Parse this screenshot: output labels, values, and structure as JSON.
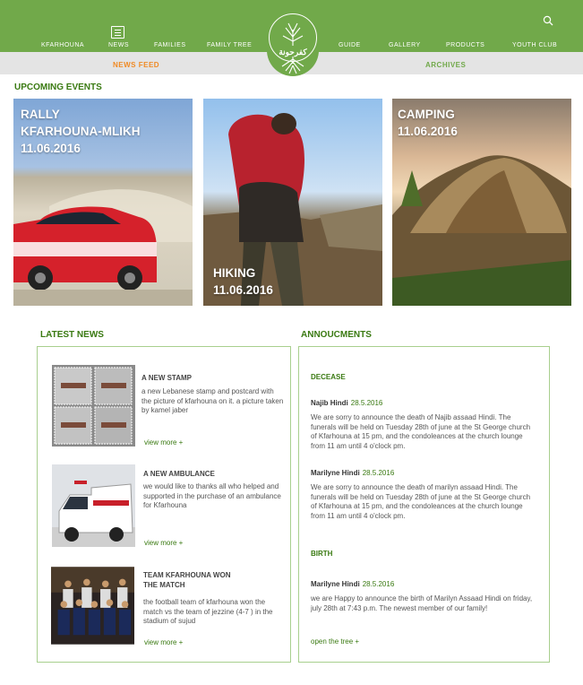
{
  "nav": {
    "left": [
      "KFARHOUNA",
      "NEWS",
      "FAMILIES",
      "FAMILY TREE"
    ],
    "right": [
      "GUIDE",
      "GALLERY",
      "PRODUCTS",
      "YOUTH CLUB"
    ]
  },
  "logo": {
    "arabic": "كفرحونة"
  },
  "subnav": {
    "feed": "NEWS FEED",
    "archives": "ARCHIVES"
  },
  "events": {
    "title": "UPCOMING EVENTS",
    "items": [
      {
        "line1": "RALLY",
        "line2": "KFARHOUNA-MLIKH",
        "date": "11.06.2016"
      },
      {
        "line1": "HIKING",
        "date": "11.06.2016"
      },
      {
        "line1": "CAMPING",
        "date": "11.06.2016"
      }
    ]
  },
  "news": {
    "title": "LATEST NEWS",
    "items": [
      {
        "title": "A NEW STAMP",
        "text": "a new Lebanese stamp and postcard with the picture of kfarhouna on it. a picture taken by kamel jaber",
        "more": "view more +"
      },
      {
        "title": "A NEW AMBULANCE",
        "text": "we would like to thanks all who helped and supported in the purchase of an ambulance for Kfarhouna",
        "more": "view more +"
      },
      {
        "title_line1": "TEAM KFARHOUNA WON",
        "title_line2": "THE MATCH",
        "text": "the football team of kfarhouna won the match vs the team of jezzine (4-7 ) in the stadium of sujud",
        "more": "view more +"
      }
    ]
  },
  "announcements": {
    "title": "ANNOUCMENTS",
    "decease_heading": "DECEASE",
    "birth_heading": "BIRTH",
    "entries": [
      {
        "name": "Najib Hindi",
        "date": "28.5.2016",
        "text": "We are sorry to announce the death of Najib assaad Hindi. The funerals will be held on Tuesday 28th of june at the St George church of Kfarhouna at 15 pm, and the condoleances at the church lounge from 11 am until 4 o'clock pm."
      },
      {
        "name": "Marilyne Hindi",
        "date": "28.5.2016",
        "text": "We are sorry to announce the death of marilyn assaad Hindi. The funerals will be held on Tuesday 28th of june at the St George church of Kfarhouna at 15 pm, and the condoleances at the church lounge from 11 am until 4 o'clock pm."
      },
      {
        "name": "Marilyne Hindi",
        "date": "28.5.2016",
        "text": "we are Happy to announce the birth of Marilyn Assaad Hindi on friday, july 28th at 7:43 p.m. The newest member of our family!"
      }
    ],
    "open_tree": "open the tree +"
  },
  "colors": {
    "brand_green": "#71a94a",
    "heading_green": "#3a7a12",
    "accent_orange": "#f08a24",
    "subbar_gray": "#e4e4e4"
  }
}
